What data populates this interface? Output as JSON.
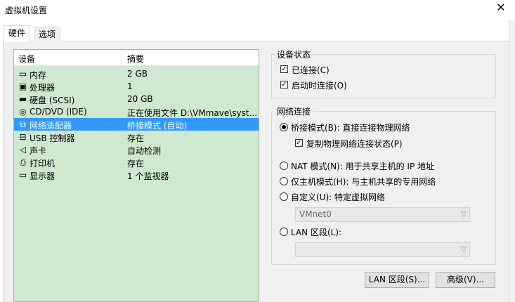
{
  "window": {
    "title": "虚拟机设置",
    "close_glyph": "✕"
  },
  "tabs": [
    {
      "label": "硬件"
    },
    {
      "label": "选项"
    }
  ],
  "device_list": {
    "col_device": "设备",
    "col_summary": "摘要",
    "rows": [
      {
        "device": "内存",
        "summary": "2 GB",
        "icon": "memory-icon"
      },
      {
        "device": "处理器",
        "summary": "1",
        "icon": "processor-icon"
      },
      {
        "device": "硬盘 (SCSI)",
        "summary": "20 GB",
        "icon": "hard-disk-icon"
      },
      {
        "device": "CD/DVD (IDE)",
        "summary": "正在使用文件 D:\\VMmave\\syst...",
        "icon": "cd-dvd-icon"
      },
      {
        "device": "网络适配器",
        "summary": "桥接模式 (自动)",
        "icon": "network-adapter-icon",
        "selected": true
      },
      {
        "device": "USB 控制器",
        "summary": "存在",
        "icon": "usb-icon"
      },
      {
        "device": "声卡",
        "summary": "自动检测",
        "icon": "sound-card-icon"
      },
      {
        "device": "打印机",
        "summary": "存在",
        "icon": "printer-icon"
      },
      {
        "device": "显示器",
        "summary": "1 个监视器",
        "icon": "display-icon"
      }
    ]
  },
  "device_status": {
    "title": "设备状态",
    "connected_label": "已连接(C)",
    "connected_checked": true,
    "connect_on_power_label": "启动时连接(O)",
    "connect_on_power_checked": true
  },
  "network": {
    "title": "网络连接",
    "bridged_label": "桥接模式(B): 直接连接物理网络",
    "replicate_label": "复制物理网络连接状态(P)",
    "replicate_checked": true,
    "nat_label": "NAT 模式(N): 用于共享主机的 IP 地址",
    "host_only_label": "仅主机模式(H): 与主机共享的专用网络",
    "custom_label": "自定义(U): 特定虚拟网络",
    "custom_value": "VMnet0",
    "lan_label": "LAN 区段(L):",
    "lan_value": "",
    "selected": "bridged"
  },
  "buttons": {
    "lan_segments": "LAN 区段(S)...",
    "advanced": "高级(V)..."
  },
  "colors": {
    "list_bg": "#cfe8cf",
    "selection": "#3399ff",
    "panel_bg": "#f0f0f0"
  }
}
